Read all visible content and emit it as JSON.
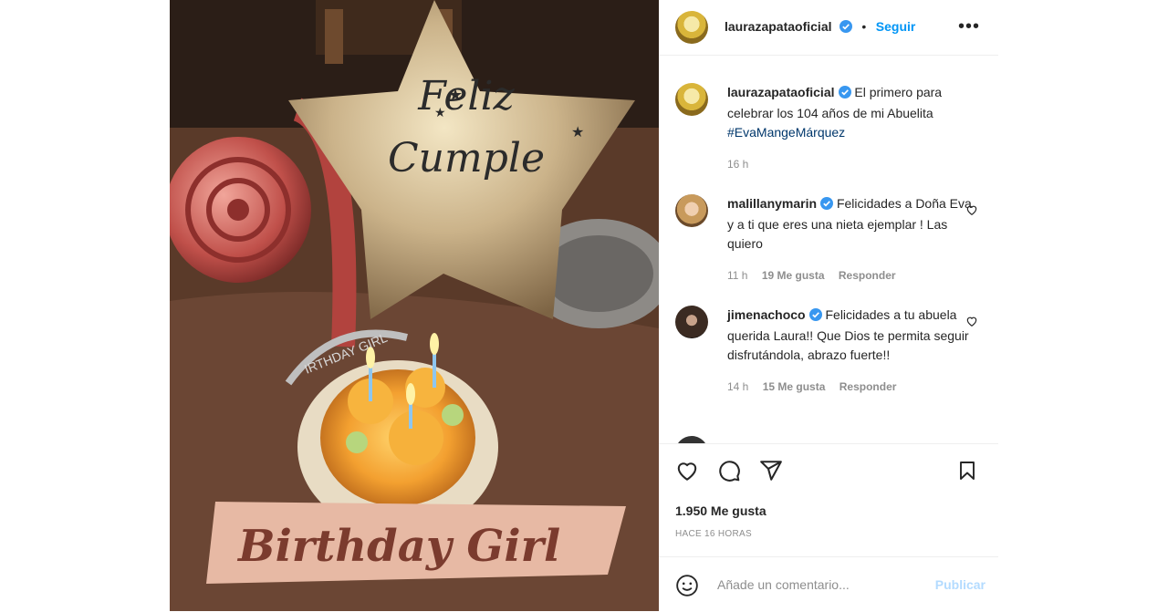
{
  "header": {
    "username": "laurazapataoficial",
    "separator": "•",
    "follow_label": "Seguir",
    "more_label": "•••"
  },
  "photo": {
    "balloon_text_line1": "Feliz",
    "balloon_text_line2": "Cumple",
    "ribbon_text": "Birthday Girl",
    "tiara_text": "IRTHDAY GIRL",
    "alt_icon": "birthday-photo"
  },
  "caption": {
    "username": "laurazapataoficial",
    "text": "El primero para celebrar los 104 años de mi Abuelita",
    "hashtag": "#EvaMangeMárquez",
    "time": "16 h"
  },
  "comments": [
    {
      "username": "malillanymarin",
      "text": "Felicidades a Doña Eva y a ti que eres una nieta ejemplar ! Las quiero",
      "time": "11 h",
      "likes": "19 Me gusta",
      "reply": "Responder"
    },
    {
      "username": "jimenachoco",
      "text": "Felicidades a tu abuela querida Laura!! Que Dios te permita seguir disfrutándola, abrazo fuerte!!",
      "time": "14 h",
      "likes": "15 Me gusta",
      "reply": "Responder"
    }
  ],
  "actions": {
    "icons": [
      "heart-icon",
      "comment-icon",
      "share-icon",
      "bookmark-icon"
    ]
  },
  "likes_label": "1.950 Me gusta",
  "time_ago": "HACE 16 HORAS",
  "add_comment": {
    "placeholder": "Añade un comentario...",
    "publish_label": "Publicar"
  },
  "colors": {
    "accent": "#0095f6",
    "verified": "#3897f0",
    "publish_disabled": "#b3dbff",
    "muted": "#8e8e8e"
  }
}
